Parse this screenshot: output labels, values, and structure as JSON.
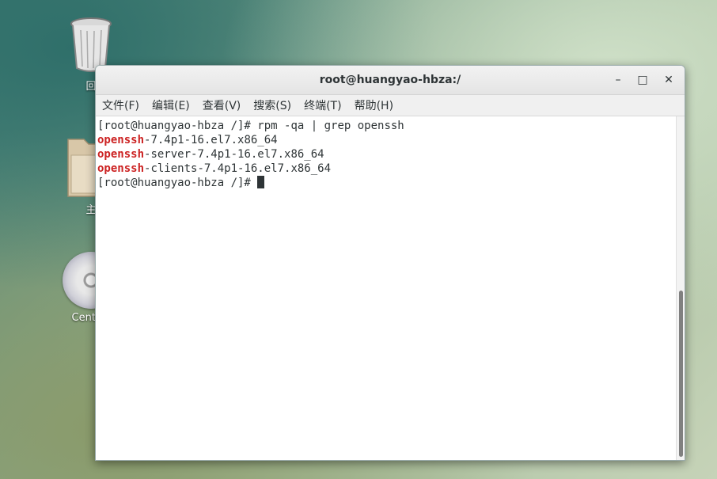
{
  "desktop": {
    "icons": [
      {
        "label": "回"
      },
      {
        "label": "主"
      },
      {
        "label": "CentOS"
      }
    ]
  },
  "window": {
    "title": "root@huangyao-hbza:/",
    "controls": {
      "minimize": "–",
      "maximize": "□",
      "close": "✕"
    },
    "menu": [
      "文件(F)",
      "编辑(E)",
      "查看(V)",
      "搜索(S)",
      "终端(T)",
      "帮助(H)"
    ]
  },
  "terminal": {
    "prompt": "[root@huangyao-hbza /]# ",
    "command": "rpm -qa | grep openssh",
    "match": "openssh",
    "results": [
      "-7.4p1-16.el7.x86_64",
      "-server-7.4p1-16.el7.x86_64",
      "-clients-7.4p1-16.el7.x86_64"
    ]
  }
}
